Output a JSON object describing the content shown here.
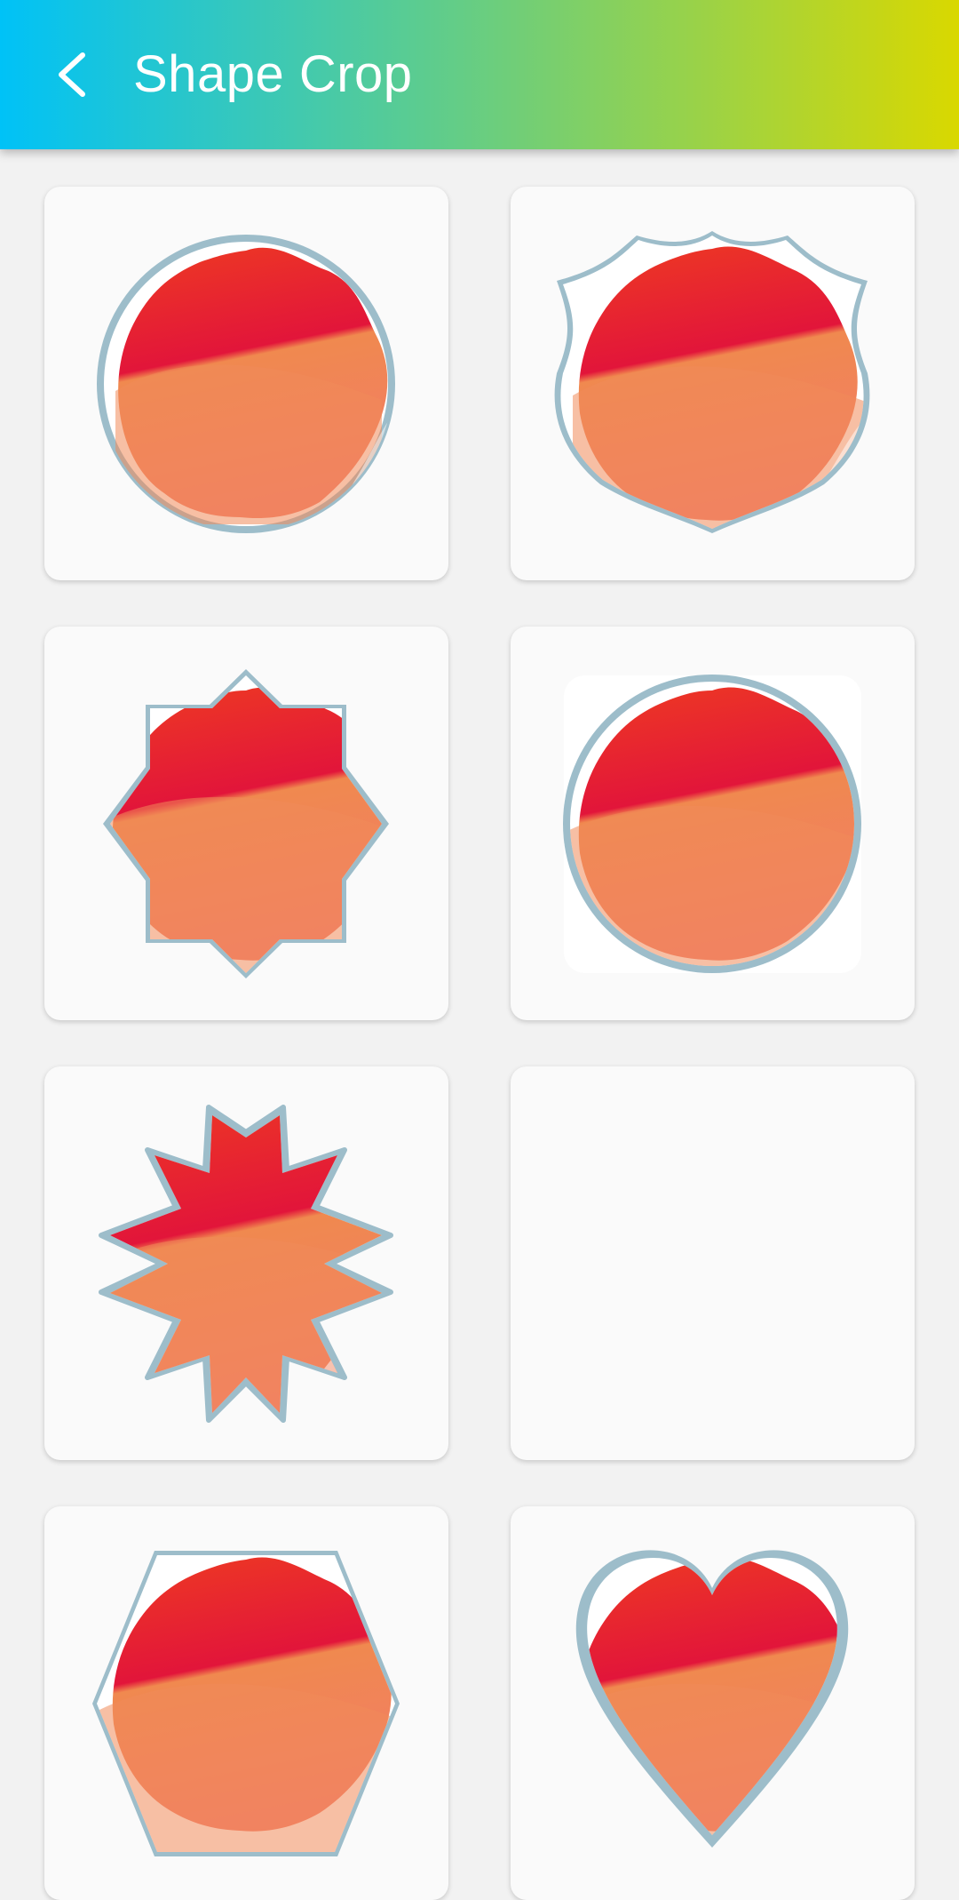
{
  "header": {
    "title": "Shape Crop",
    "back_icon": "chevron-left-icon"
  },
  "colors": {
    "gradient_start": "#00c2f7",
    "gradient_end": "#d9d800",
    "card_bg": "#fafafa",
    "page_bg": "#f2f2f2",
    "border_texture": "#8fb4c4",
    "photo_top": "#ea2a2a",
    "photo_bottom": "#f07a5e"
  },
  "shapes": [
    {
      "id": "circle",
      "icon": "circle-shape-icon"
    },
    {
      "id": "shield",
      "icon": "shield-shape-icon"
    },
    {
      "id": "octagram",
      "icon": "octagram-shape-icon"
    },
    {
      "id": "rounded-circle-square",
      "icon": "rounded-square-shape-icon"
    },
    {
      "id": "star-12",
      "icon": "star-shape-icon"
    },
    {
      "id": "striped-circle",
      "icon": "striped-circle-shape-icon"
    },
    {
      "id": "hexagon",
      "icon": "hexagon-shape-icon"
    },
    {
      "id": "heart",
      "icon": "heart-shape-icon"
    }
  ]
}
